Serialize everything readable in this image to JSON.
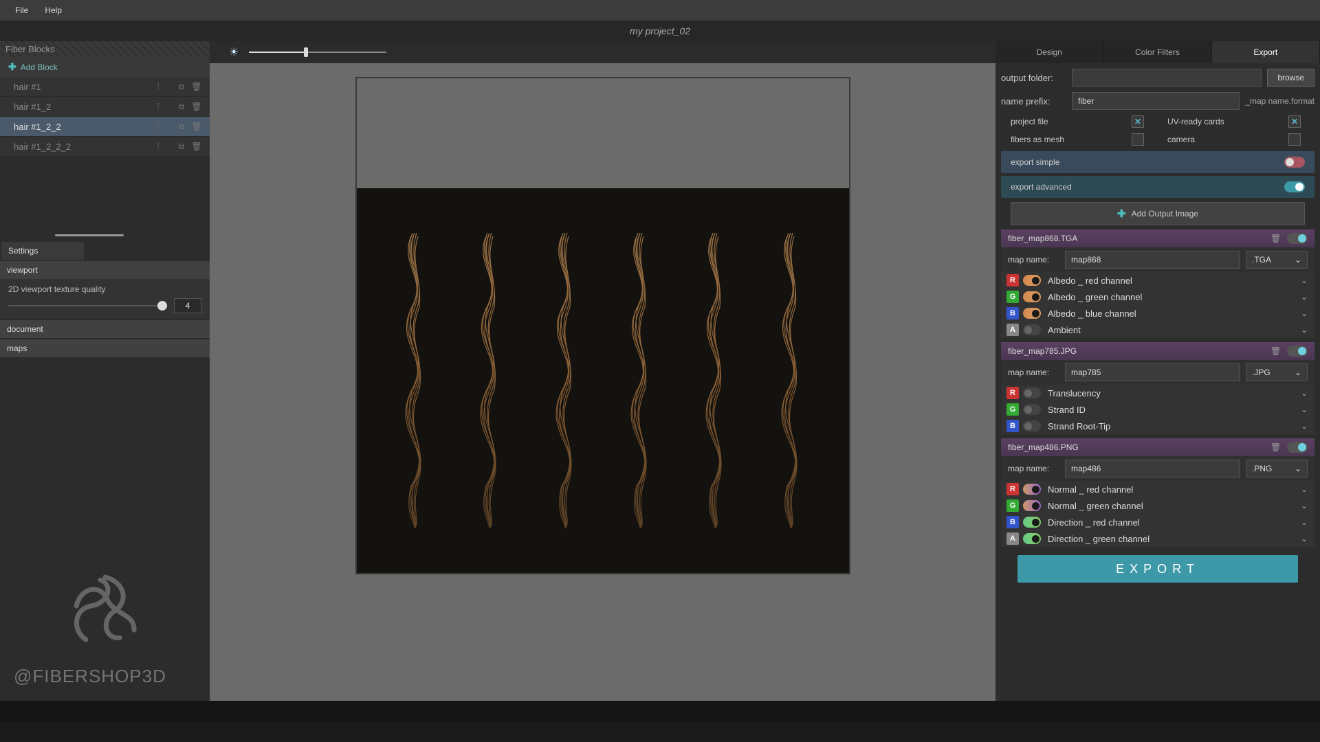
{
  "menu": {
    "file": "File",
    "help": "Help"
  },
  "title": "my project_02",
  "sidebar": {
    "header": "Fiber Blocks",
    "add": "Add Block",
    "items": [
      {
        "label": "hair #1"
      },
      {
        "label": "hair #1_2"
      },
      {
        "label": "hair #1_2_2"
      },
      {
        "label": "hair #1_2_2_2"
      }
    ]
  },
  "settings": {
    "tab": "Settings",
    "viewport": "viewport",
    "quality_label": "2D viewport texture quality",
    "quality_value": "4",
    "document": "document",
    "maps": "maps"
  },
  "watermark": "@FIBERSHOP3D",
  "tabs": {
    "design": "Design",
    "color": "Color Filters",
    "export": "Export"
  },
  "export": {
    "output_folder": "output folder:",
    "output_value": "",
    "browse": "browse",
    "name_prefix": "name prefix:",
    "prefix_value": "fiber",
    "suffix": "_map name.format",
    "project_file": "project file",
    "uv_cards": "UV-ready cards",
    "fibers_mesh": "fibers as mesh",
    "camera": "camera",
    "simple": "export simple",
    "advanced": "export advanced",
    "add_output": "Add Output Image",
    "map_name_lbl": "map name:",
    "formats": [
      ".TGA",
      ".JPG",
      ".PNG"
    ],
    "outputs": [
      {
        "header": "fiber_map868.TGA",
        "map": "map868",
        "fmt": ".TGA",
        "channels": [
          {
            "c": "R",
            "on": true,
            "t": "tA",
            "label": "Albedo _ red channel"
          },
          {
            "c": "G",
            "on": true,
            "t": "tA",
            "label": "Albedo _ green channel"
          },
          {
            "c": "B",
            "on": true,
            "t": "tA",
            "label": "Albedo _ blue channel"
          },
          {
            "c": "A",
            "on": false,
            "t": "off",
            "label": "Ambient"
          }
        ]
      },
      {
        "header": "fiber_map785.JPG",
        "map": "map785",
        "fmt": ".JPG",
        "channels": [
          {
            "c": "R",
            "on": false,
            "t": "off",
            "label": "Translucency"
          },
          {
            "c": "G",
            "on": false,
            "t": "off",
            "label": "Strand ID"
          },
          {
            "c": "B",
            "on": false,
            "t": "off",
            "label": "Strand Root-Tip"
          }
        ]
      },
      {
        "header": "fiber_map486.PNG",
        "map": "map486",
        "fmt": ".PNG",
        "channels": [
          {
            "c": "R",
            "on": true,
            "t": "tN",
            "label": "Normal _ red channel"
          },
          {
            "c": "G",
            "on": true,
            "t": "tN",
            "label": "Normal _ green channel"
          },
          {
            "c": "B",
            "on": true,
            "t": "tD",
            "label": "Direction _ red channel"
          },
          {
            "c": "A",
            "on": true,
            "t": "tD",
            "label": "Direction _ green channel"
          }
        ]
      }
    ],
    "export_btn": "EXPORT"
  }
}
